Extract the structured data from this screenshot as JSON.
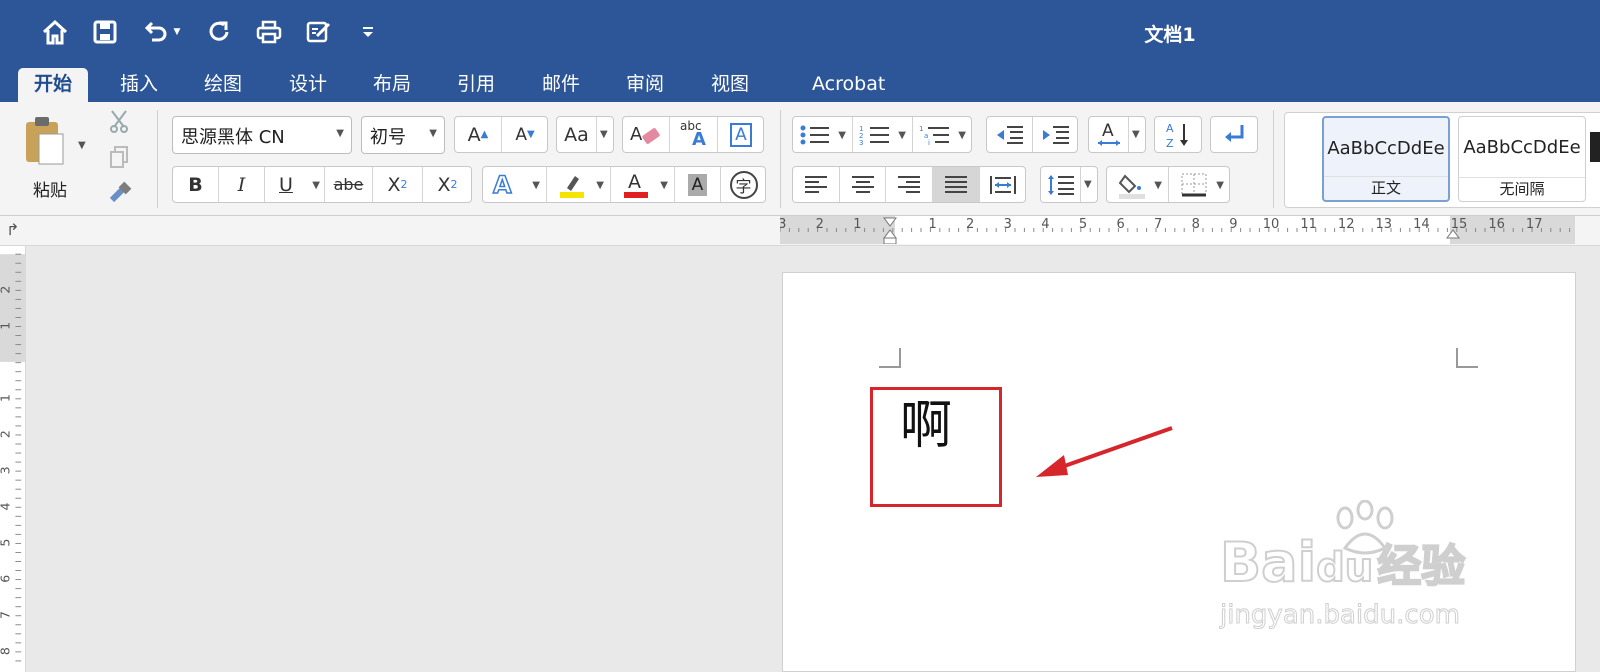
{
  "window": {
    "title": "文档1"
  },
  "quick_access": [
    "home-icon",
    "save-icon",
    "undo-icon",
    "redo-icon",
    "print-icon",
    "edit-icon",
    "customize-icon"
  ],
  "tabs": [
    {
      "label": "开始",
      "active": true
    },
    {
      "label": "插入"
    },
    {
      "label": "绘图"
    },
    {
      "label": "设计"
    },
    {
      "label": "布局"
    },
    {
      "label": "引用"
    },
    {
      "label": "邮件"
    },
    {
      "label": "审阅"
    },
    {
      "label": "视图"
    },
    {
      "label": "Acrobat"
    }
  ],
  "ribbon": {
    "paste_label": "粘贴",
    "font_name": "思源黑体 CN",
    "font_size": "初号",
    "bold": "B",
    "italic": "I",
    "underline": "U",
    "strike": "abe",
    "subscript": "X",
    "subscript_small": "2",
    "superscript": "X",
    "superscript_small": "2",
    "phonetic": "abc",
    "enclose": "字",
    "highlight_color": "#f5e400",
    "font_color": "#e02020",
    "styles": [
      {
        "sample": "AaBbCcDdEe",
        "name": "正文"
      },
      {
        "sample": "AaBbCcDdEe",
        "name": "无间隔"
      }
    ]
  },
  "ruler": {
    "h_labels": [
      "3",
      "2",
      "1",
      "1",
      "2",
      "3",
      "4",
      "5",
      "6",
      "7",
      "8",
      "9",
      "10",
      "11",
      "12",
      "13",
      "14",
      "15",
      "16",
      "17"
    ],
    "v_labels": [
      "2",
      "1",
      "1",
      "2",
      "3",
      "4",
      "5",
      "6",
      "7",
      "8"
    ]
  },
  "document": {
    "character": "啊"
  },
  "watermark": {
    "brand": "Bai",
    "brand2": "du",
    "brand_cn": "经验",
    "url": "jingyan.baidu.com"
  },
  "colors": {
    "titlebar": "#2c5697",
    "annotation": "#d6262b"
  }
}
